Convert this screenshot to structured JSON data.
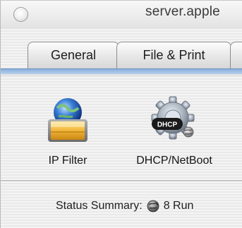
{
  "window": {
    "title": "server.apple"
  },
  "tabs": [
    {
      "label": "General"
    },
    {
      "label": "File & Print"
    },
    {
      "label": ""
    }
  ],
  "services": [
    {
      "label": "IP Filter",
      "icon": "ip-filter-icon"
    },
    {
      "label": "DHCP/NetBoot",
      "icon": "dhcp-netboot-icon",
      "badge": "DHCP"
    }
  ],
  "status": {
    "label": "Status Summary:",
    "value": "8 Run",
    "icon": "globe-icon"
  },
  "colors": {
    "accent_blue": "#8ab0dc",
    "text": "#202020"
  }
}
